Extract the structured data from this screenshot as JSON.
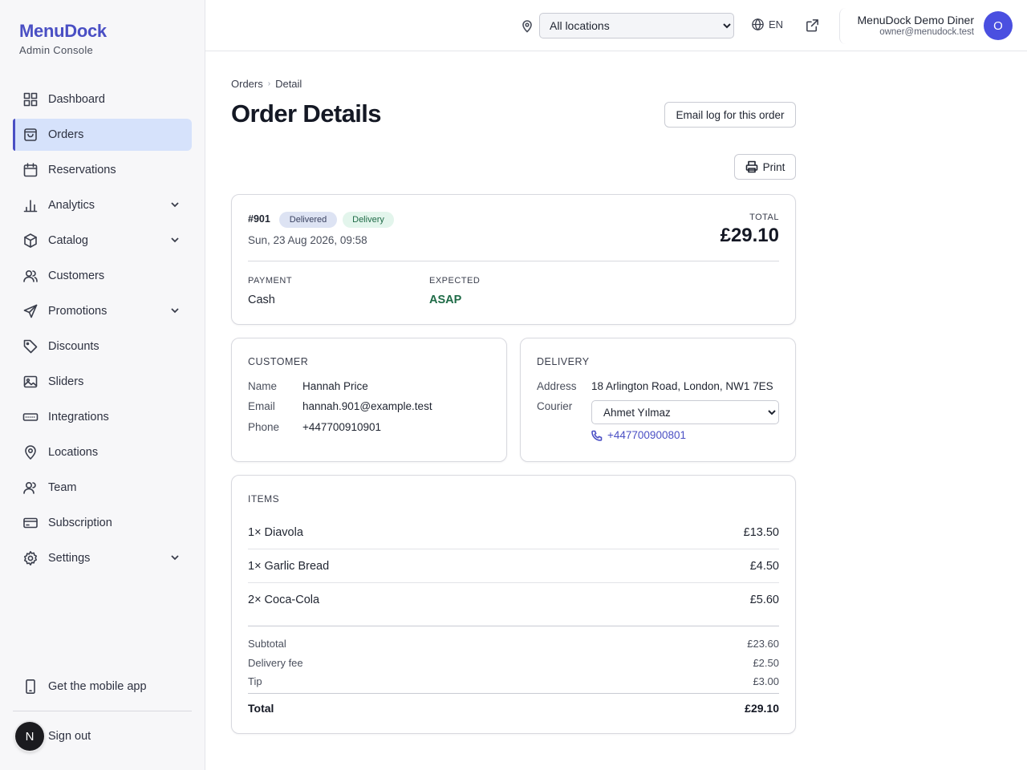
{
  "brand": {
    "name": "MenuDock",
    "subtitle": "Admin Console"
  },
  "sidebar": {
    "items": [
      {
        "label": "Dashboard",
        "icon": "dashboard-grid-icon"
      },
      {
        "label": "Orders",
        "icon": "shopping-bag-icon",
        "active": true
      },
      {
        "label": "Reservations",
        "icon": "calendar-icon"
      },
      {
        "label": "Analytics",
        "icon": "bar-chart-icon",
        "expandable": true
      },
      {
        "label": "Catalog",
        "icon": "box-icon",
        "expandable": true
      },
      {
        "label": "Customers",
        "icon": "users-icon"
      },
      {
        "label": "Promotions",
        "icon": "send-icon",
        "expandable": true
      },
      {
        "label": "Discounts",
        "icon": "tag-icon"
      },
      {
        "label": "Sliders",
        "icon": "image-icon"
      },
      {
        "label": "Integrations",
        "icon": "keyboard-icon"
      },
      {
        "label": "Locations",
        "icon": "map-pin-icon"
      },
      {
        "label": "Team",
        "icon": "team-icon"
      },
      {
        "label": "Subscription",
        "icon": "credit-card-icon"
      },
      {
        "label": "Settings",
        "icon": "gear-icon",
        "expandable": true
      }
    ],
    "mobile_app_label": "Get the mobile app",
    "signout_label": "Sign out",
    "signout_avatar_initial": "N"
  },
  "header": {
    "location_selected": "All locations",
    "language": "EN",
    "user_name": "MenuDock Demo Diner",
    "user_email": "owner@menudock.test",
    "user_initial": "O"
  },
  "breadcrumb": {
    "parent": "Orders",
    "current": "Detail"
  },
  "page": {
    "title": "Order Details",
    "email_log_label": "Email log for this order",
    "print_label": "Print"
  },
  "order": {
    "number": "#901",
    "status": "Delivered",
    "type": "Delivery",
    "date": "Sun, 23 Aug 2026, 09:58",
    "total_label": "TOTAL",
    "total": "£29.10",
    "payment_label": "PAYMENT",
    "payment": "Cash",
    "expected_label": "EXPECTED",
    "expected": "ASAP"
  },
  "customer": {
    "title": "CUSTOMER",
    "name_label": "Name",
    "name": "Hannah Price",
    "email_label": "Email",
    "email": "hannah.901@example.test",
    "phone_label": "Phone",
    "phone": "+447700910901"
  },
  "delivery": {
    "title": "DELIVERY",
    "address_label": "Address",
    "address": "18 Arlington Road, London, NW1 7ES",
    "courier_label": "Courier",
    "courier": "Ahmet Yılmaz",
    "courier_phone": "+447700900801"
  },
  "items": {
    "title": "ITEMS",
    "rows": [
      {
        "qty": "1×",
        "name": "Diavola",
        "price": "£13.50"
      },
      {
        "qty": "1×",
        "name": "Garlic Bread",
        "price": "£4.50"
      },
      {
        "qty": "2×",
        "name": "Coca-Cola",
        "price": "£5.60"
      }
    ],
    "subtotal_label": "Subtotal",
    "subtotal": "£23.60",
    "delivery_fee_label": "Delivery fee",
    "delivery_fee": "£2.50",
    "tip_label": "Tip",
    "tip": "£3.00",
    "total_label": "Total",
    "total": "£29.10"
  },
  "colors": {
    "accent": "#4a4fc4",
    "active_bg": "#d6e2fb",
    "success": "#1f6b47"
  }
}
